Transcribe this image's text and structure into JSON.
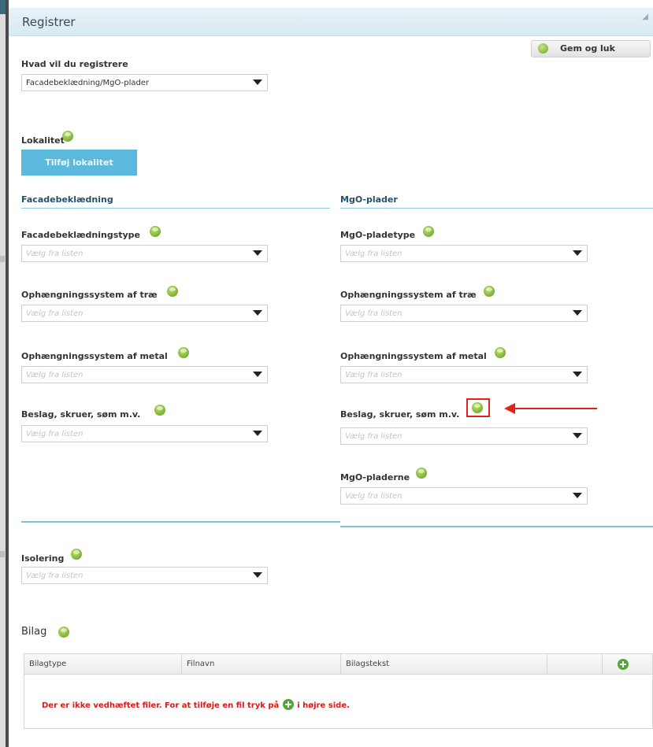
{
  "window": {
    "title": "Registrer",
    "save_label": "Gem og luk"
  },
  "register_type": {
    "label": "Hvad vil du registrere",
    "value": "Facadebeklædning/MgO-plader"
  },
  "locality": {
    "label": "Lokalitet",
    "add_button": "Tilføj lokalitet"
  },
  "placeholder": "Vælg fra listen",
  "facade": {
    "heading": "Facadebeklædning",
    "fields": [
      {
        "label": "Facadebeklædningstype"
      },
      {
        "label": "Ophængningssystem af træ"
      },
      {
        "label": "Ophængningssystem af metal"
      },
      {
        "label": "Beslag, skruer, søm m.v."
      }
    ]
  },
  "mgo": {
    "heading": "MgO-plader",
    "fields": [
      {
        "label": "MgO-pladetype"
      },
      {
        "label": "Ophængningssystem af træ"
      },
      {
        "label": "Ophængningssystem af metal"
      },
      {
        "label": "Beslag, skruer, søm m.v."
      },
      {
        "label": "MgO-pladerne"
      }
    ]
  },
  "insulation": {
    "label": "Isolering"
  },
  "attachments": {
    "label": "Bilag",
    "columns": [
      "Bilagtype",
      "Filnavn",
      "Bilagstekst"
    ],
    "empty_message_part1": "Der er ikke vedhæftet filer. For at tilføje en fil tryk på",
    "empty_message_part2": "i højre side."
  },
  "colors": {
    "accent": "#5bb9dd",
    "help_icon": "#6aa520",
    "error_text": "#d81b1b",
    "annotation": "#e2231a"
  }
}
